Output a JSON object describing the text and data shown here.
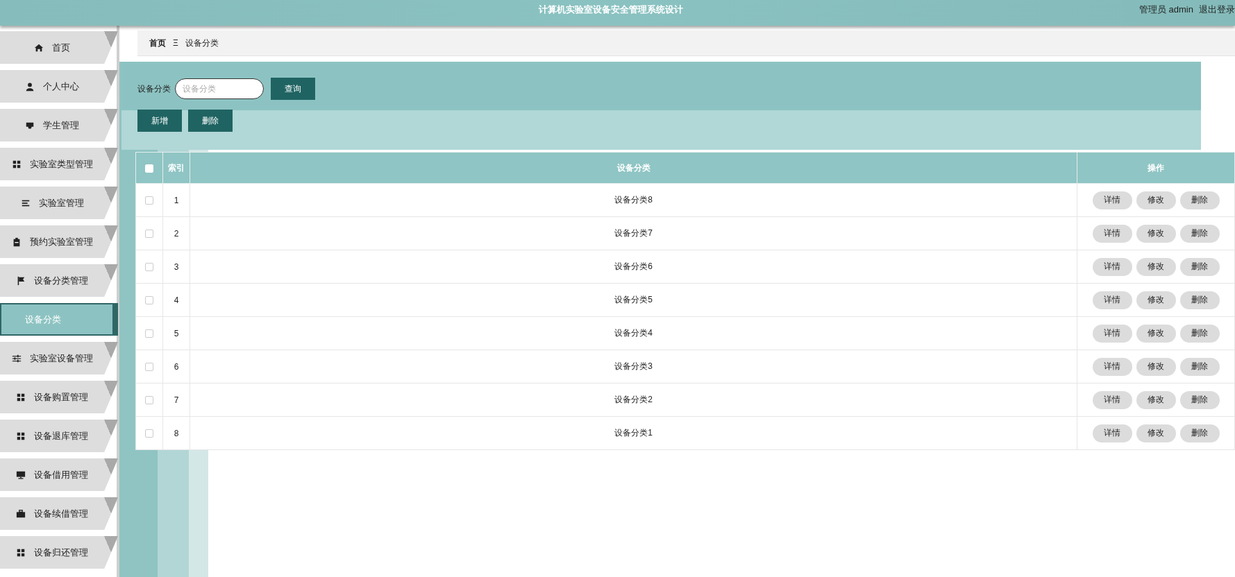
{
  "header": {
    "title": "计算机实验室设备安全管理系统设计",
    "user": "管理员 admin",
    "logout": "退出登录"
  },
  "sidebar": {
    "items": [
      {
        "label": "首页",
        "selected": false
      },
      {
        "label": "个人中心",
        "selected": false
      },
      {
        "label": "学生管理",
        "selected": false
      },
      {
        "label": "实验室类型管理",
        "selected": false
      },
      {
        "label": "实验室管理",
        "selected": false
      },
      {
        "label": "预约实验室管理",
        "selected": false
      },
      {
        "label": "设备分类管理",
        "selected": false,
        "children": [
          {
            "label": "设备分类",
            "selected": true
          }
        ]
      },
      {
        "label": "实验室设备管理",
        "selected": false
      },
      {
        "label": "设备购置管理",
        "selected": false
      },
      {
        "label": "设备退库管理",
        "selected": false
      },
      {
        "label": "设备借用管理",
        "selected": false
      },
      {
        "label": "设备续借管理",
        "selected": false
      },
      {
        "label": "设备归还管理",
        "selected": false
      }
    ]
  },
  "breadcrumb": {
    "home": "首页",
    "separator": "Ξ",
    "current": "设备分类"
  },
  "search": {
    "label": "设备分类",
    "placeholder": "设备分类",
    "button": "查询"
  },
  "actions": [
    "新增",
    "删除"
  ],
  "table": {
    "header_checked": false,
    "columns": [
      "索引",
      "设备分类",
      "操作"
    ],
    "rows": [
      {
        "checked": false,
        "index": "1",
        "name": "设备分类8",
        "buttons": [
          "详情",
          "修改",
          "删除"
        ]
      },
      {
        "checked": false,
        "index": "2",
        "name": "设备分类7",
        "buttons": [
          "详情",
          "修改",
          "删除"
        ]
      },
      {
        "checked": false,
        "index": "3",
        "name": "设备分类6",
        "buttons": [
          "详情",
          "修改",
          "删除"
        ]
      },
      {
        "checked": false,
        "index": "4",
        "name": "设备分类5",
        "buttons": [
          "详情",
          "修改",
          "删除"
        ]
      },
      {
        "checked": false,
        "index": "5",
        "name": "设备分类4",
        "buttons": [
          "详情",
          "修改",
          "删除"
        ]
      },
      {
        "checked": false,
        "index": "6",
        "name": "设备分类3",
        "buttons": [
          "详情",
          "修改",
          "删除"
        ]
      },
      {
        "checked": false,
        "index": "7",
        "name": "设备分类2",
        "buttons": [
          "详情",
          "修改",
          "删除"
        ]
      },
      {
        "checked": false,
        "index": "8",
        "name": "设备分类1",
        "buttons": [
          "详情",
          "修改",
          "删除"
        ]
      }
    ]
  }
}
